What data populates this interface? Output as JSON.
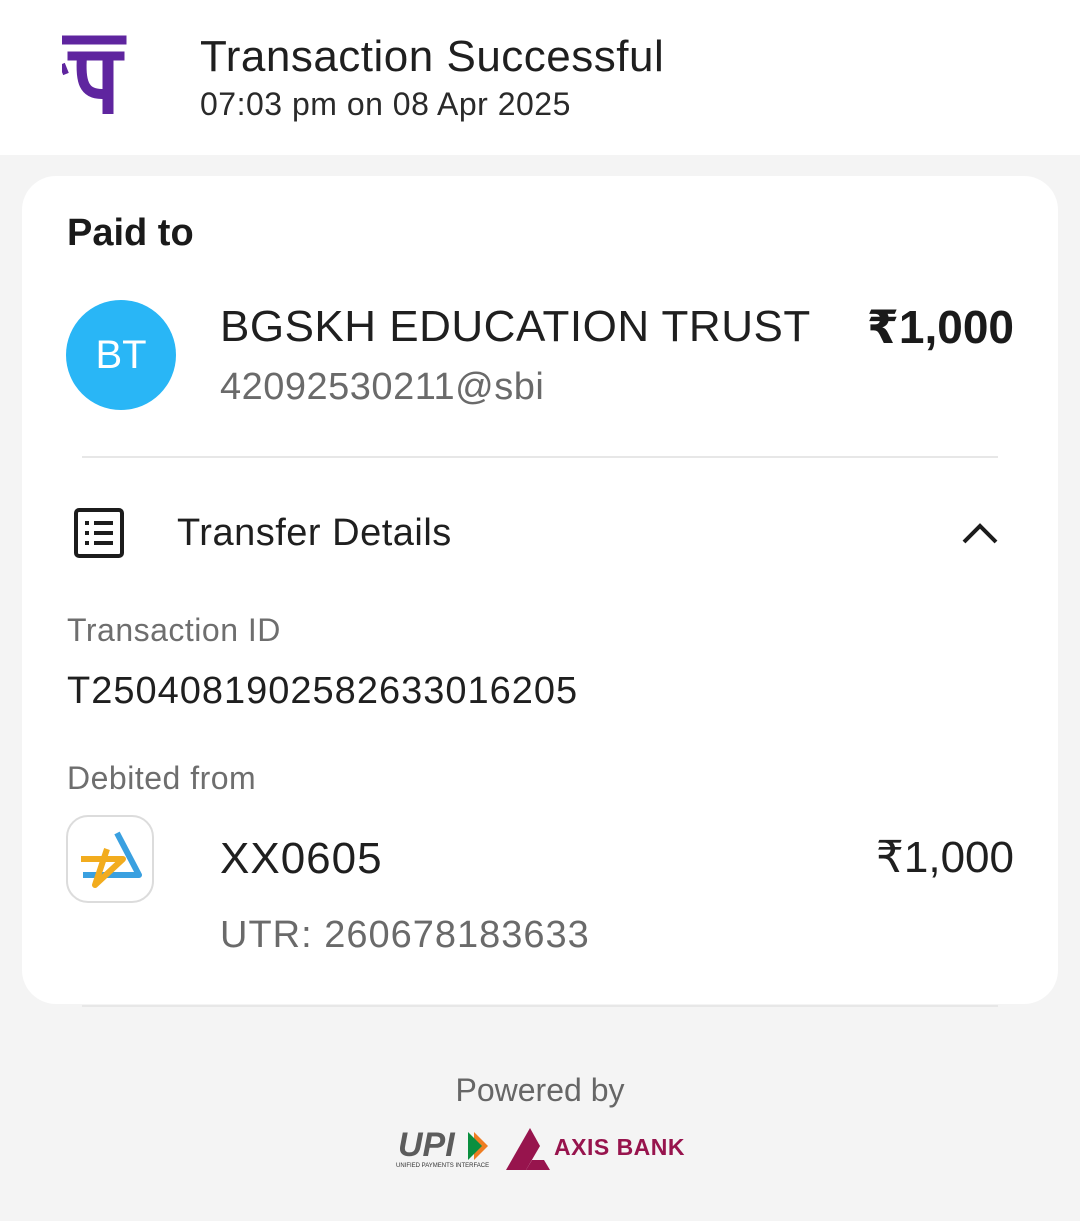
{
  "header": {
    "title": "Transaction Successful",
    "timestamp": "07:03 pm on 08 Apr 2025",
    "logo_icon": "phonepe-logo",
    "brand_color": "#5f259f"
  },
  "paid_to": {
    "heading": "Paid to",
    "avatar_initials": "BT",
    "avatar_color": "#29b6f6",
    "name": "BGSKH EDUCATION TRUST",
    "upi_id": "42092530211@sbi",
    "amount": "₹1,000"
  },
  "transfer_details": {
    "title": "Transfer Details",
    "icon": "receipt-list-icon",
    "toggle_icon": "chevron-up-icon",
    "transaction_id_label": "Transaction ID",
    "transaction_id": "T2504081902582633016205",
    "debited_from_label": "Debited from",
    "bank_icon": "sbi-yono-icon",
    "account": "XX0605",
    "utr": "UTR: 260678183633",
    "amount": "₹1,000"
  },
  "footer": {
    "powered_by": "Powered by",
    "upi_logo_text": "UPI",
    "upi_subtitle": "UNIFIED PAYMENTS INTERFACE",
    "bank_logo_text": "AXIS BANK",
    "axis_color": "#97144d"
  }
}
